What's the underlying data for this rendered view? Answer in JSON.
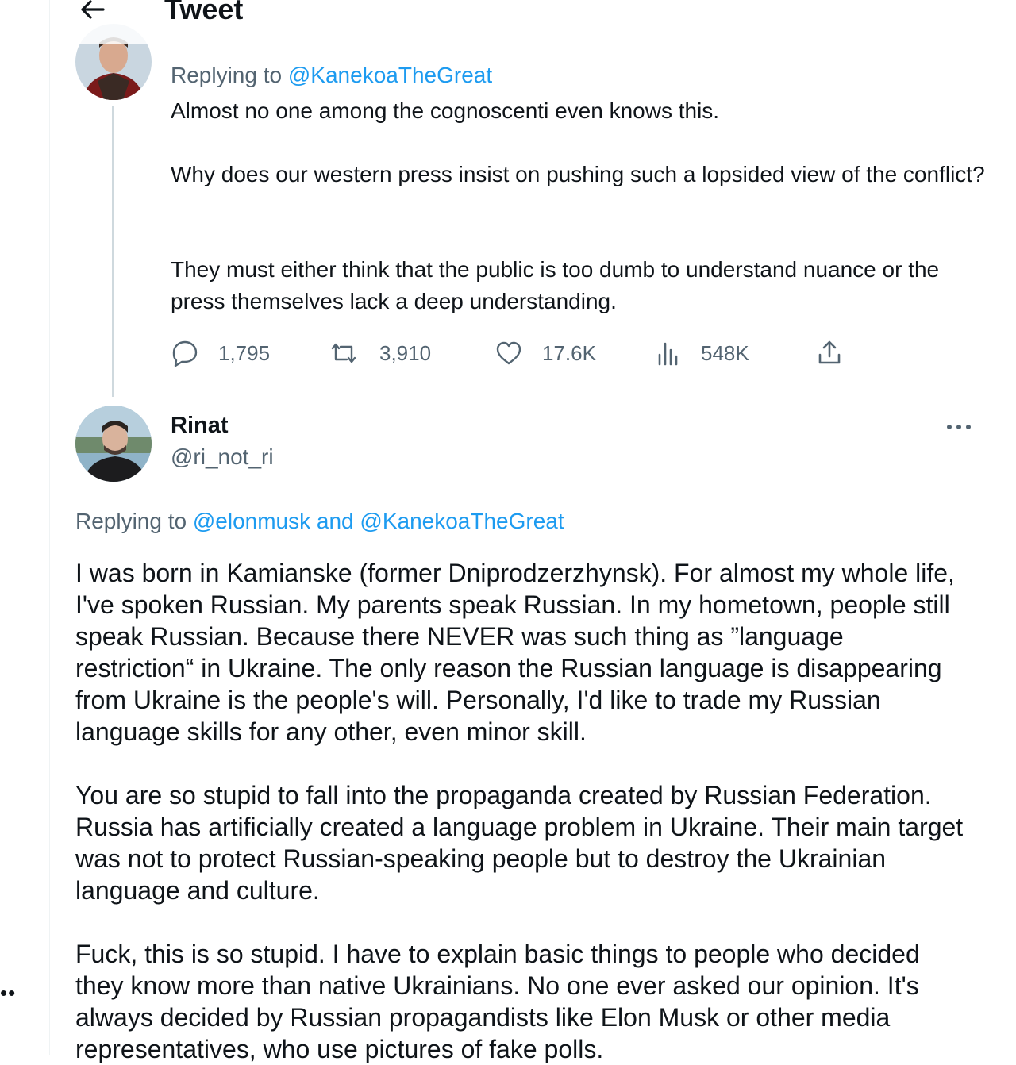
{
  "header": {
    "title": "Tweet"
  },
  "parent_tweet": {
    "replying_prefix": "Replying to",
    "replying_mention": "@KanekoaTheGreat",
    "paragraphs": [
      "Almost no one among the cognoscenti even knows this.",
      "Why does our western press insist on pushing such a lopsided view of the conflict?",
      "They must either think that the public is too dumb to understand nuance or the press themselves lack a deep understanding."
    ],
    "stats": {
      "replies": "1,795",
      "retweets": "3,910",
      "likes": "17.6K",
      "views": "548K"
    }
  },
  "reply_tweet": {
    "author_name": "Rinat",
    "author_handle": "@ri_not_ri",
    "replying_prefix": "Replying to",
    "replying_mentions": "@elonmusk and @KanekoaTheGreat",
    "paragraphs": [
      "I was born in Kamianske (former Dniprodzerzhynsk). For almost my whole life, I've spoken Russian. My parents speak Russian. In my hometown, people still speak Russian. Because there NEVER was such thing as ”language restriction“ in Ukraine. The only reason the Russian language is disappearing from Ukraine is the people's will. Personally, I'd like to trade my Russian language skills for any other, even minor skill.",
      "You are so stupid to fall into the propaganda created by Russian Federation. Russia has artificially created a language problem in Ukraine. Their main target was not to protect Russian-speaking people but to destroy the Ukrainian language and culture.",
      "Fuck, this is so stupid. I have to explain basic things to people who decided they know more than native Ukrainians. No one ever asked our opinion. It's always decided by Russian propagandists like Elon Musk or other media representatives, who use pictures of fake polls."
    ]
  },
  "sidebar": {
    "dots": "••"
  },
  "colors": {
    "link": "#1d9bf0",
    "secondary_text": "#536471",
    "primary_text": "#0f1419",
    "thread_line": "#cfd9de"
  }
}
